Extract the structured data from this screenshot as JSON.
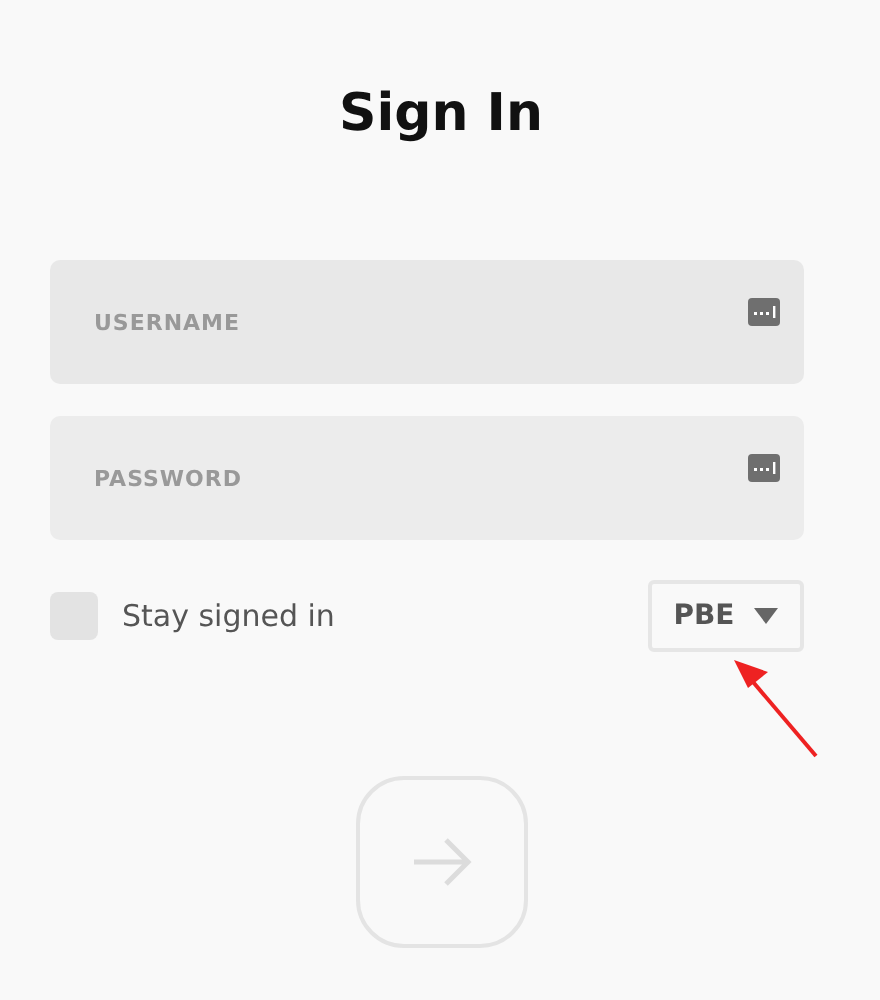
{
  "title": "Sign In",
  "fields": [
    {
      "placeholder": "USERNAME"
    },
    {
      "placeholder": "PASSWORD"
    }
  ],
  "stay_signed_in": {
    "label": "Stay signed in",
    "checked": false
  },
  "region_dropdown": {
    "value": "PBE"
  },
  "submit_button": {
    "disabled": true
  }
}
